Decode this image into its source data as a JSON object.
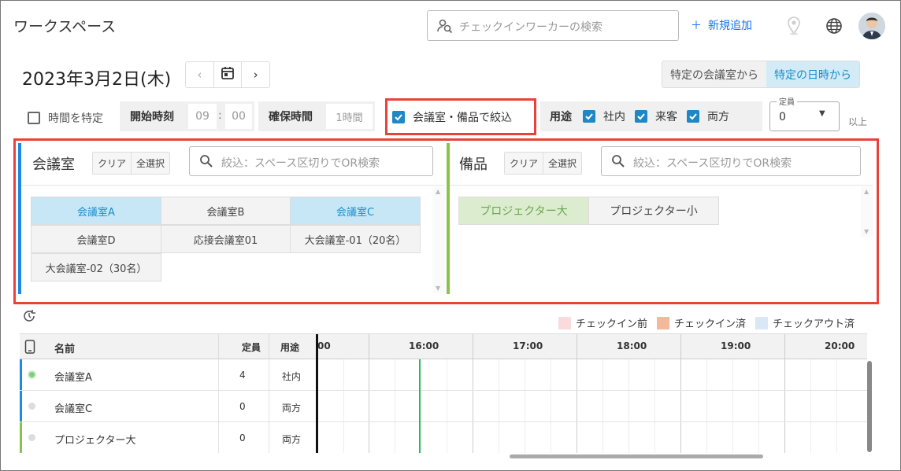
{
  "header": {
    "title": "ワークスペース",
    "search_placeholder": "チェックインワーカーの検索",
    "new_add": "新規追加"
  },
  "datebar": {
    "date": "2023年3月2日(木)",
    "prev": "‹",
    "next": "›",
    "mode_room": "特定の会議室から",
    "mode_datetime": "特定の日時から"
  },
  "filters": {
    "time_specify": "時間を特定",
    "start_label": "開始時刻",
    "start_h": "09",
    "colon": ":",
    "start_m": "00",
    "duration_label": "確保時間",
    "duration_value": "1時間",
    "narrow_label": "会議室・備品で絞込",
    "usage_label": "用途",
    "usage_internal": "社内",
    "usage_guest": "来客",
    "usage_both": "両方",
    "capacity_label": "定員",
    "capacity_value": "0",
    "capacity_suffix": "以上"
  },
  "rooms": {
    "title": "会議室",
    "clear": "クリア",
    "select_all": "全選択",
    "filter_placeholder": "絞込：スペース区切りでOR検索",
    "items": [
      {
        "label": "会議室A",
        "selected": true
      },
      {
        "label": "会議室B",
        "selected": false
      },
      {
        "label": "会議室C",
        "selected": true
      },
      {
        "label": "会議室D",
        "selected": false
      },
      {
        "label": "応接会議室01",
        "selected": false
      },
      {
        "label": "大会議室-01（20名）",
        "selected": false
      },
      {
        "label": "大会議室-02（30名）",
        "selected": false
      }
    ]
  },
  "equipment": {
    "title": "備品",
    "clear": "クリア",
    "select_all": "全選択",
    "filter_placeholder": "絞込：スペース区切りでOR検索",
    "items": [
      {
        "label": "プロジェクター大",
        "selected": true
      },
      {
        "label": "プロジェクター小",
        "selected": false
      }
    ]
  },
  "legend": {
    "before": "チェックイン前",
    "checked_in": "チェックイン済",
    "checked_out": "チェックアウト済",
    "colors": {
      "before": "#fadadd",
      "checked_in": "#f4b89a",
      "checked_out": "#d9e8f4"
    }
  },
  "table": {
    "col_name": "名前",
    "col_capacity": "定員",
    "col_usage": "用途",
    "time_partial": "00",
    "times": [
      "16:00",
      "17:00",
      "18:00",
      "19:00",
      "20:00"
    ],
    "rows": [
      {
        "name": "会議室A",
        "capacity": "4",
        "usage": "社内",
        "status": "active"
      },
      {
        "name": "会議室C",
        "capacity": "0",
        "usage": "両方",
        "status": "idle"
      },
      {
        "name": "プロジェクター大",
        "capacity": "0",
        "usage": "両方",
        "status": "idle"
      }
    ]
  }
}
